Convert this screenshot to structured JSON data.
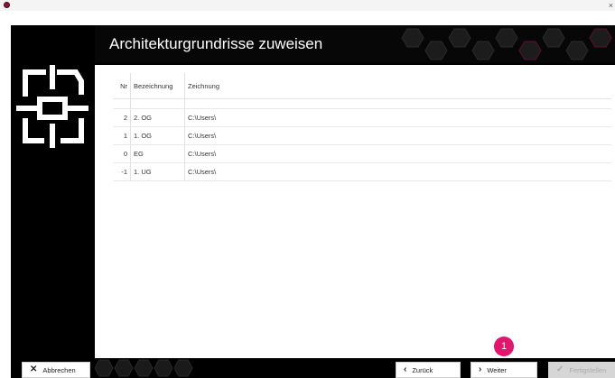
{
  "window": {
    "close_glyph": "×"
  },
  "wizard": {
    "title": "Architekturgrundrisse zuweisen"
  },
  "table": {
    "columns": [
      "Nr",
      "Bezeichnung",
      "Zeichnung"
    ],
    "rows": [
      {
        "nr": "2",
        "bez": "2. OG",
        "zeich": "C:\\Users\\"
      },
      {
        "nr": "1",
        "bez": "1. OG",
        "zeich": "C:\\Users\\"
      },
      {
        "nr": "0",
        "bez": "EG",
        "zeich": "C:\\Users\\"
      },
      {
        "nr": "-1",
        "bez": "1. UG",
        "zeich": "C:\\Users\\"
      }
    ]
  },
  "footer": {
    "cancel_label": "Abbrechen",
    "back_label": "Zurück",
    "next_label": "Weiter",
    "finish_label": "Fertigstellen",
    "cancel_icon": "✕",
    "back_icon": "‹",
    "next_icon": "›",
    "finish_icon": "✓"
  },
  "badge": {
    "text": "1"
  },
  "colors": {
    "accent": "#e0176d",
    "header_bg": "#070707",
    "frame_bg": "#000000"
  },
  "icons": [
    "app-icon",
    "floorplan-logo-icon",
    "close-icon",
    "chevron-left-icon",
    "chevron-right-icon",
    "check-icon"
  ]
}
